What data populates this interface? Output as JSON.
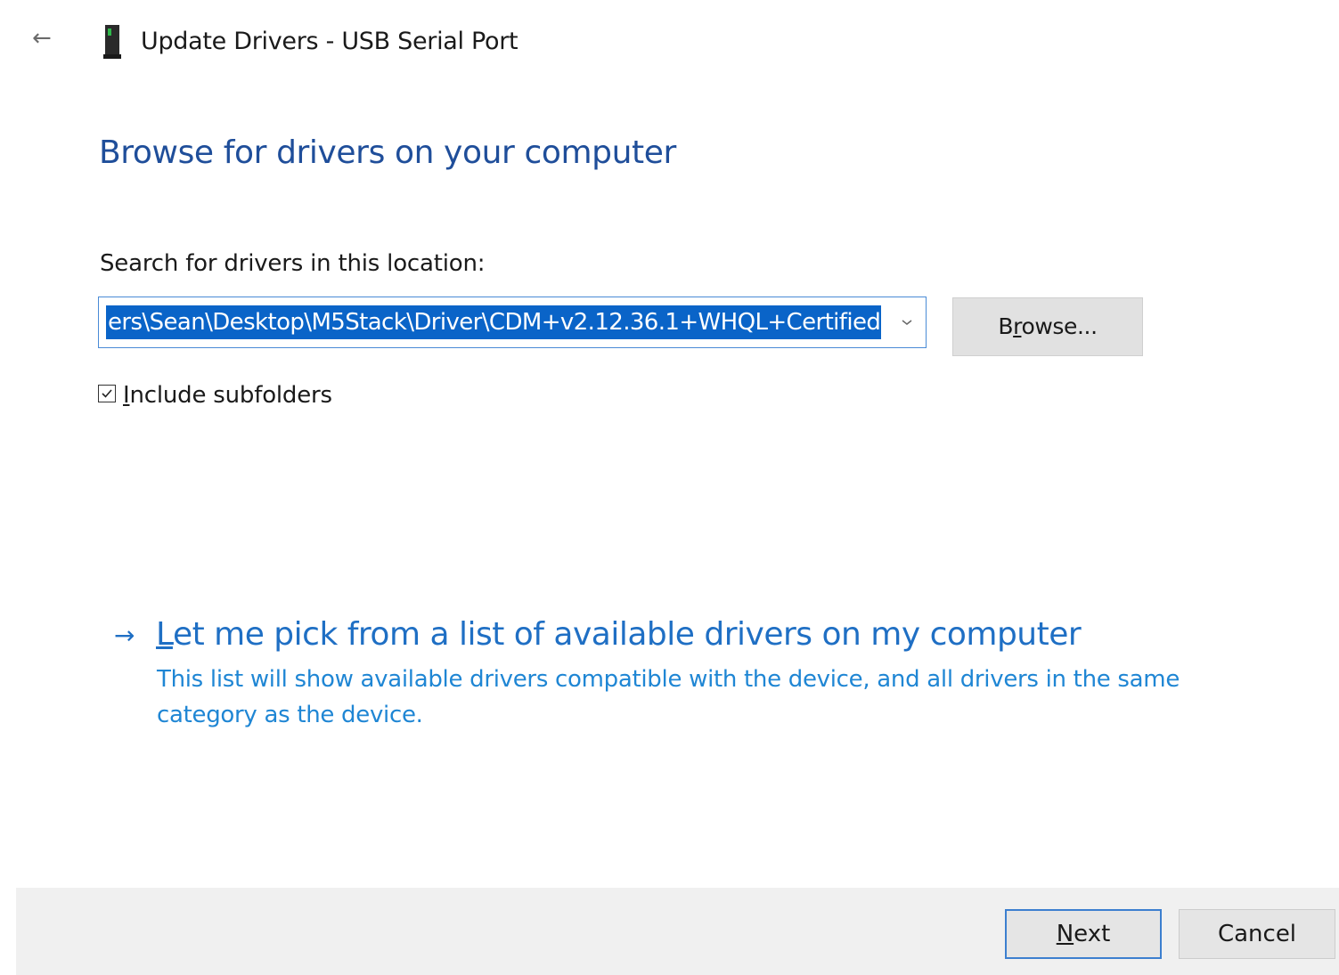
{
  "window": {
    "title": "Update Drivers - USB Serial Port",
    "back_icon": "back-arrow-icon",
    "device_icon": "usb-device-icon"
  },
  "main": {
    "heading": "Browse for drivers on your computer",
    "search_label": "Search for drivers in this location:",
    "location_value": "ers\\Sean\\Desktop\\M5Stack\\Driver\\CDM+v2.12.36.1+WHQL+Certified",
    "location_selected": true,
    "browse_label_prefix": "B",
    "browse_label_accel": "r",
    "browse_label_suffix": "owse...",
    "include_subfolders": {
      "checked": true,
      "label_accel": "I",
      "label_rest": "nclude subfolders"
    }
  },
  "pick_option": {
    "title_accel": "L",
    "title_rest": "et me pick from a list of available drivers on my computer",
    "description": "This list will show available drivers compatible with the device, and all drivers in the same category as the device."
  },
  "footer": {
    "next_accel": "N",
    "next_rest": "ext",
    "cancel_label": "Cancel"
  },
  "colors": {
    "heading": "#1f4e9a",
    "link": "#1f6fc4",
    "selection": "#0a64c8",
    "footer_bg": "#f0f0f0"
  }
}
